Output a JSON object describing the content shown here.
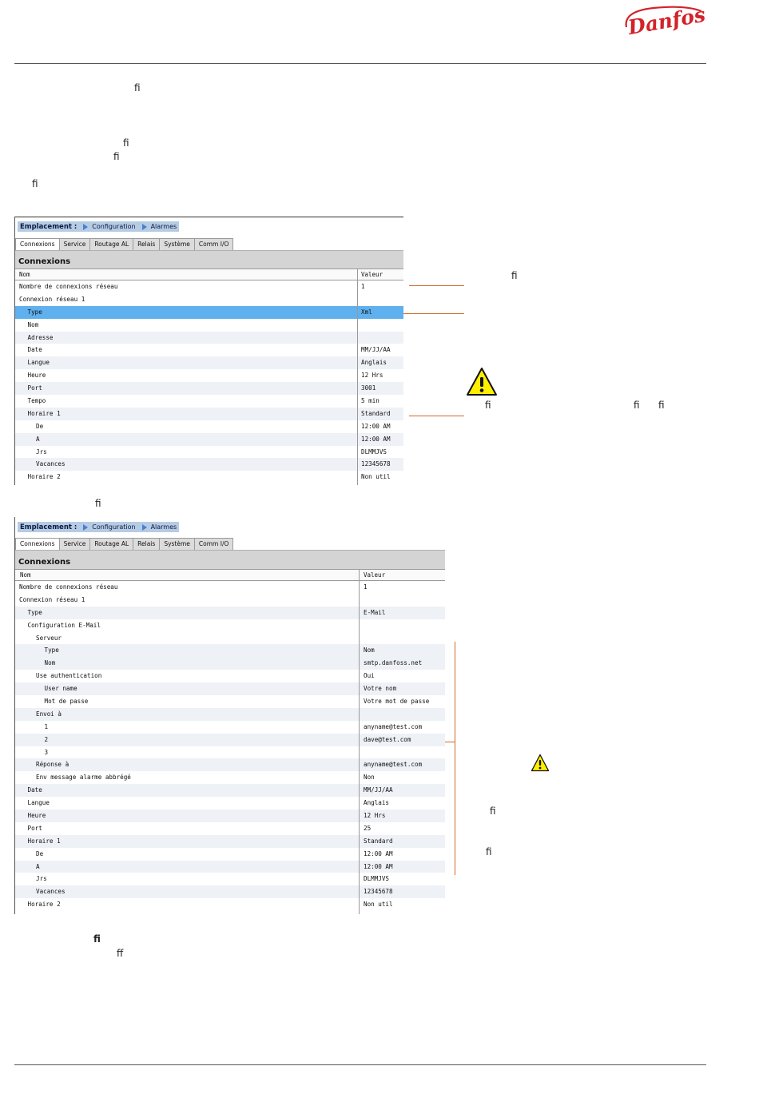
{
  "brand": {
    "logo_text": "Danfoss",
    "color": "#d2232a"
  },
  "accent_colors": {
    "annotation_line": "#d2692a",
    "selected_row": "#5fb0ee",
    "breadcrumb_bg": "#b6cbe4"
  },
  "ligatures": [
    {
      "text": "ﬁ"
    },
    {
      "text": "ﬁ"
    },
    {
      "text": "ﬁ"
    },
    {
      "text": "ﬁ"
    },
    {
      "text": "ﬁ"
    },
    {
      "text": "ﬁ"
    },
    {
      "text": "ﬁ"
    },
    {
      "text": "ﬁ"
    },
    {
      "text": "ﬁ"
    },
    {
      "text": "ﬁ"
    },
    {
      "text": "ﬁ"
    },
    {
      "text": "ﬁ"
    },
    {
      "text": "ﬀ"
    }
  ],
  "screen1": {
    "breadcrumb": {
      "label": "Emplacement :",
      "items": [
        "Configuration",
        "Alarmes"
      ]
    },
    "tabs": [
      "Connexions",
      "Service",
      "Routage AL",
      "Relais",
      "Système",
      "Comm I/O"
    ],
    "section_title": "Connexions",
    "columns": {
      "name": "Nom",
      "value": "Valeur"
    },
    "rows": [
      {
        "name": "Nombre de connexions réseau",
        "value": "1"
      },
      {
        "name": "Connexion réseau 1",
        "value": ""
      },
      {
        "name": "Type",
        "value": "Xml"
      },
      {
        "name": "Nom",
        "value": ""
      },
      {
        "name": "Adresse",
        "value": ""
      },
      {
        "name": "Date",
        "value": "MM/JJ/AA"
      },
      {
        "name": "Langue",
        "value": "Anglais"
      },
      {
        "name": "Heure",
        "value": "12 Hrs"
      },
      {
        "name": "Port",
        "value": "3001"
      },
      {
        "name": "Tempo",
        "value": "5 min"
      },
      {
        "name": "Horaire 1",
        "value": "Standard"
      },
      {
        "name": "De",
        "value": "12:00 AM"
      },
      {
        "name": "A",
        "value": "12:00 AM"
      },
      {
        "name": "Jrs",
        "value": "DLMMJVS"
      },
      {
        "name": "Vacances",
        "value": "12345678"
      },
      {
        "name": "Horaire 2",
        "value": "Non util"
      }
    ]
  },
  "screen2": {
    "breadcrumb": {
      "label": "Emplacement :",
      "items": [
        "Configuration",
        "Alarmes"
      ]
    },
    "tabs": [
      "Connexions",
      "Service",
      "Routage AL",
      "Relais",
      "Système",
      "Comm I/O"
    ],
    "section_title": "Connexions",
    "columns": {
      "name": "Nom",
      "value": "Valeur"
    },
    "rows": [
      {
        "name": "Nombre de connexions réseau",
        "value": "1"
      },
      {
        "name": "Connexion réseau 1",
        "value": ""
      },
      {
        "name": "Type",
        "value": "E-Mail"
      },
      {
        "name": "Configuration E-Mail",
        "value": ""
      },
      {
        "name": "Serveur",
        "value": ""
      },
      {
        "name": "Type",
        "value": "Nom"
      },
      {
        "name": "Nom",
        "value": "smtp.danfoss.net"
      },
      {
        "name": "Use authentication",
        "value": "Oui"
      },
      {
        "name": "User name",
        "value": "Votre nom"
      },
      {
        "name": "Mot de passe",
        "value": "Votre mot de passe"
      },
      {
        "name": "Envoi à",
        "value": ""
      },
      {
        "name": "1",
        "value": "anyname@test.com"
      },
      {
        "name": "2",
        "value": "dave@test.com"
      },
      {
        "name": "3",
        "value": ""
      },
      {
        "name": "Réponse à",
        "value": "anyname@test.com"
      },
      {
        "name": "Env message alarme abbrégé",
        "value": "Non"
      },
      {
        "name": "Date",
        "value": "MM/JJ/AA"
      },
      {
        "name": "Langue",
        "value": "Anglais"
      },
      {
        "name": "Heure",
        "value": "12 Hrs"
      },
      {
        "name": "Port",
        "value": "25"
      },
      {
        "name": "Horaire 1",
        "value": "Standard"
      },
      {
        "name": "De",
        "value": "12:00 AM"
      },
      {
        "name": "A",
        "value": "12:00 AM"
      },
      {
        "name": "Jrs",
        "value": "DLMMJVS"
      },
      {
        "name": "Vacances",
        "value": "12345678"
      },
      {
        "name": "Horaire 2",
        "value": "Non util"
      }
    ]
  }
}
